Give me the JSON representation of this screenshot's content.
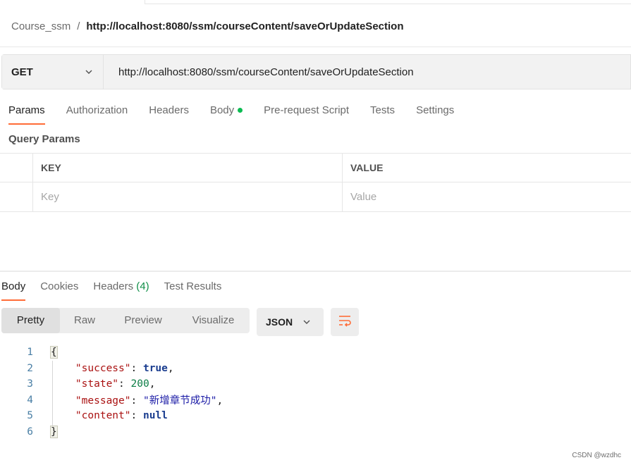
{
  "breadcrumb": {
    "parent": "Course_ssm",
    "separator": "/",
    "current": "http://localhost:8080/ssm/courseContent/saveOrUpdateSection"
  },
  "request": {
    "method": "GET",
    "url": "http://localhost:8080/ssm/courseContent/saveOrUpdateSection"
  },
  "request_tabs": [
    "Params",
    "Authorization",
    "Headers",
    "Body",
    "Pre-request Script",
    "Tests",
    "Settings"
  ],
  "query_params": {
    "title": "Query Params",
    "columns": {
      "key": "KEY",
      "value": "VALUE"
    },
    "placeholders": {
      "key": "Key",
      "value": "Value"
    }
  },
  "response_tabs": {
    "body": "Body",
    "cookies": "Cookies",
    "headers": "Headers",
    "headers_count": "(4)",
    "test_results": "Test Results"
  },
  "view_modes": [
    "Pretty",
    "Raw",
    "Preview",
    "Visualize"
  ],
  "format": "JSON",
  "code": {
    "line_numbers": [
      "1",
      "2",
      "3",
      "4",
      "5",
      "6"
    ],
    "open_brace": "{",
    "close_brace": "}",
    "success_key": "\"success\"",
    "success_val": "true",
    "state_key": "\"state\"",
    "state_val": "200",
    "message_key": "\"message\"",
    "message_val": "\"新增章节成功\"",
    "content_key": "\"content\"",
    "content_val": "null"
  },
  "watermark": "CSDN @wzdhc",
  "colors": {
    "accent": "#ff6c37",
    "body_dot": "#0cbb52",
    "headers_count": "#0f8e47"
  }
}
